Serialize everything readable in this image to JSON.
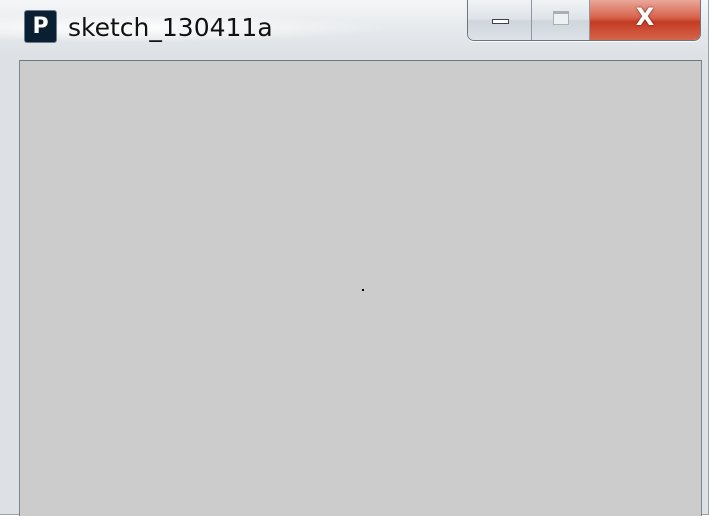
{
  "window": {
    "title": "sketch_130411a",
    "app_icon": {
      "name": "processing-app-icon",
      "glyph": "P"
    },
    "controls": {
      "minimize": "minimize-icon",
      "maximize": "maximize-icon",
      "close": "close-icon",
      "close_glyph": "X"
    }
  },
  "canvas": {
    "background_color": "#cccccc",
    "point_color": "#000000"
  },
  "colors": {
    "close_button": "#c94a33",
    "titlebar": "#e6e9ec"
  }
}
